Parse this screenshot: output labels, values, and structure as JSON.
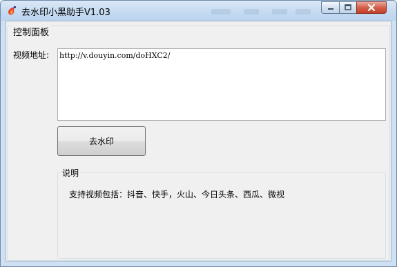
{
  "window": {
    "title": "去水印小黑助手V1.03",
    "icon": "app-icon",
    "controls": [
      "minimize-icon",
      "maximize-icon",
      "close-icon"
    ],
    "close_color": "#c7402b"
  },
  "panel": {
    "title": "控制面板",
    "url_label": "视频地址:",
    "url_value": "http://v.douyin.com/doHXC2/",
    "action_button": "去水印",
    "info": {
      "title": "说明",
      "text": "支持视频包括：抖音、快手，火山、今日头条、西瓜、微视"
    }
  }
}
